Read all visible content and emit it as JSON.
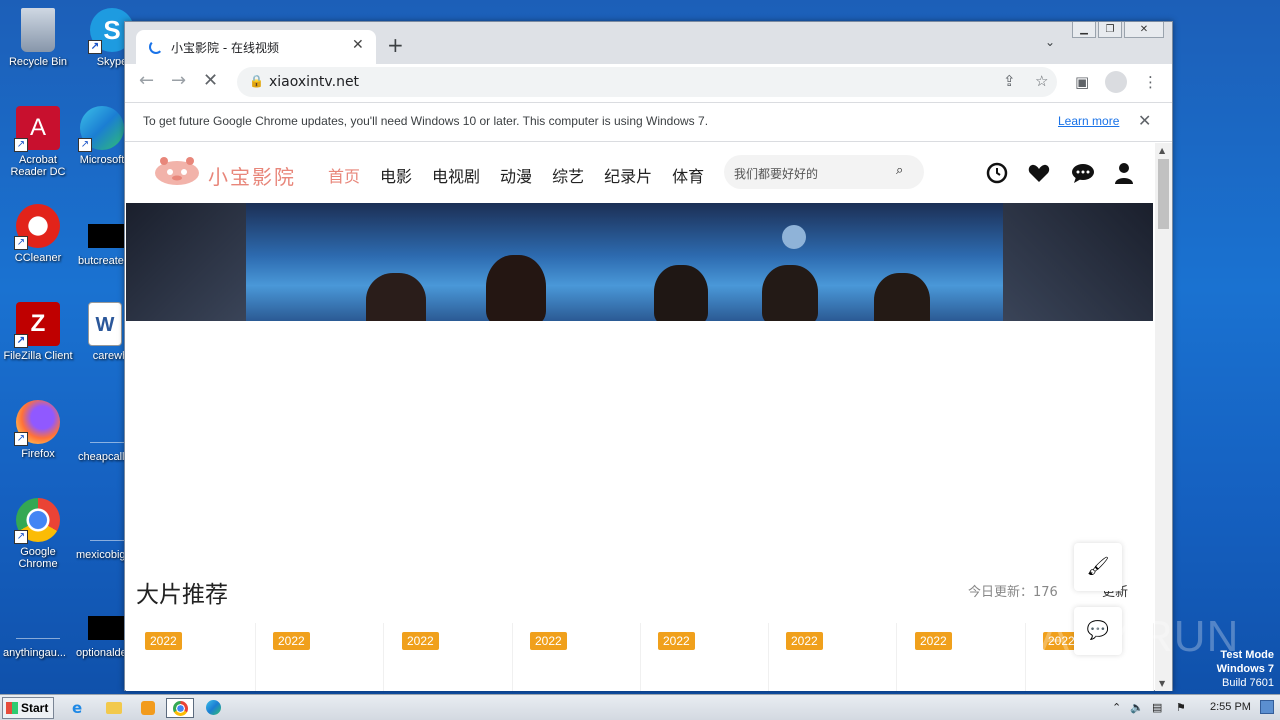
{
  "desktop": {
    "icons": [
      {
        "label": "Recycle Bin"
      },
      {
        "label": "Skype"
      },
      {
        "label": "Acrobat Reader DC"
      },
      {
        "label": "Microsoft"
      },
      {
        "label": "CCleaner"
      },
      {
        "label": "butcreate"
      },
      {
        "label": "FileZilla Client"
      },
      {
        "label": "carewhile"
      },
      {
        "label": "Firefox"
      },
      {
        "label": "cheapcall"
      },
      {
        "label": "Google Chrome"
      },
      {
        "label": "mexicobig"
      },
      {
        "label": "anythingau..."
      },
      {
        "label": "optionalde"
      }
    ],
    "watermark": "ANY.RUN",
    "test_mode": [
      "Test Mode",
      "Windows 7",
      "Build 7601"
    ]
  },
  "browser": {
    "tab_title": "小宝影院 - 在线视频",
    "url": "xiaoxintv.net",
    "infobar_message": "To get future Google Chrome updates, you'll need Windows 10 or later. This computer is using Windows 7.",
    "infobar_link": "Learn more"
  },
  "site": {
    "logo_text": "小宝影院",
    "nav": [
      "首页",
      "电影",
      "电视剧",
      "动漫",
      "综艺",
      "纪录片",
      "体育"
    ],
    "search_placeholder": "我们都要好好的",
    "section_title": "大片推荐",
    "today_update": "今日更新：176",
    "today_update_right": "更新",
    "cards": [
      {
        "year": "2022"
      },
      {
        "year": "2022"
      },
      {
        "year": "2022"
      },
      {
        "year": "2022"
      },
      {
        "year": "2022"
      },
      {
        "year": "2022"
      },
      {
        "year": "2022"
      },
      {
        "year": "2022"
      }
    ]
  },
  "taskbar": {
    "start_label": "Start",
    "clock": "2:55 PM"
  },
  "colors": {
    "accent": "#e8867a",
    "badge": "#f0a01c",
    "chrome_blue": "#1a73e8"
  }
}
